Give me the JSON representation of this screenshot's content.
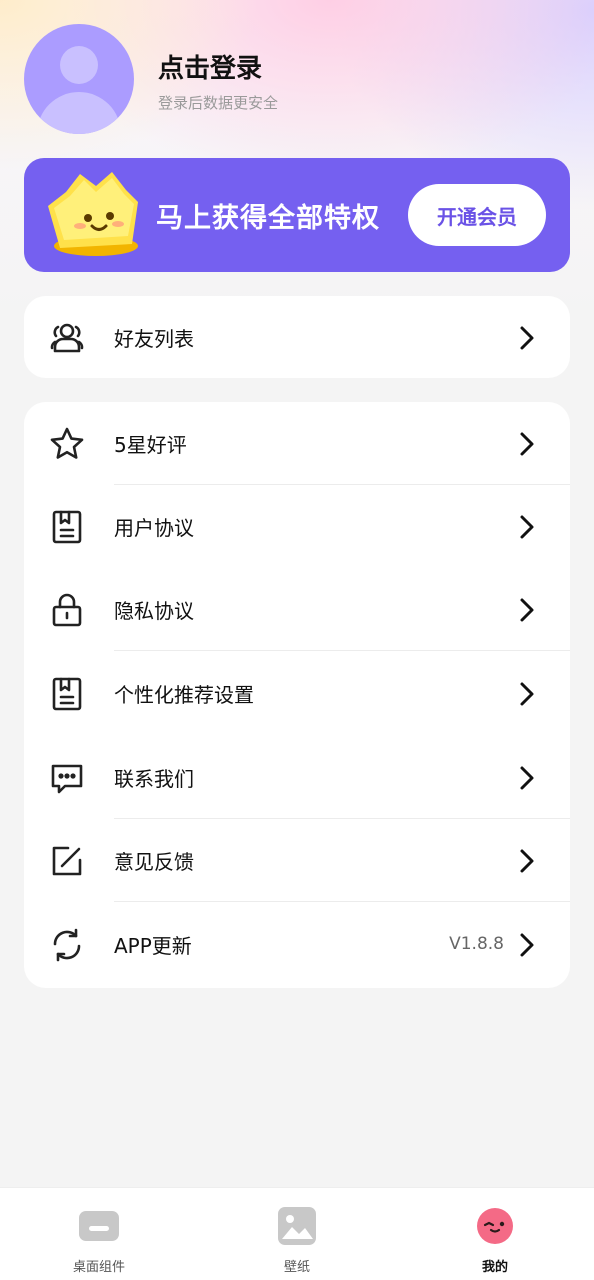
{
  "profile": {
    "title": "点击登录",
    "subtitle": "登录后数据更安全"
  },
  "vip": {
    "text": "马上获得全部特权",
    "button": "开通会员",
    "accent": "#7560f0"
  },
  "friends": {
    "label": "好友列表",
    "icon": "users-icon"
  },
  "menu": {
    "items": [
      {
        "label": "5星好评",
        "icon": "star-icon"
      },
      {
        "label": "用户协议",
        "icon": "document-icon"
      },
      {
        "label": "隐私协议",
        "icon": "lock-icon"
      },
      {
        "label": "个性化推荐设置",
        "icon": "document-icon"
      },
      {
        "label": "联系我们",
        "icon": "chat-icon"
      },
      {
        "label": "意见反馈",
        "icon": "edit-icon"
      },
      {
        "label": "APP更新",
        "icon": "refresh-icon",
        "value": "V1.8.8"
      }
    ]
  },
  "tabbar": {
    "tabs": [
      {
        "label": "桌面组件",
        "icon": "widget-icon",
        "active": false
      },
      {
        "label": "壁纸",
        "icon": "image-icon",
        "active": false
      },
      {
        "label": "我的",
        "icon": "face-icon",
        "active": true
      }
    ]
  }
}
